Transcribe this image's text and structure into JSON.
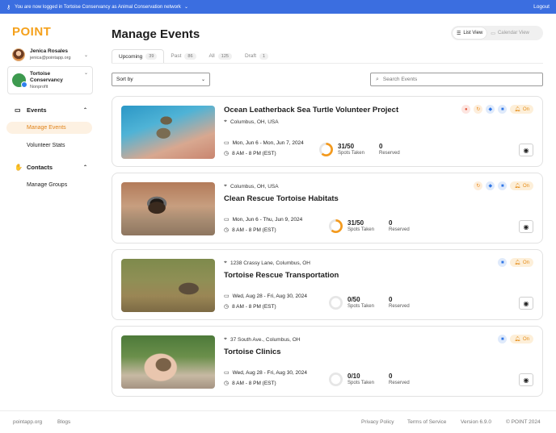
{
  "banner": {
    "message": "You are now logged in Tortoise Conservancy as Animal Conservation network",
    "logout": "Logout"
  },
  "app": {
    "logo": "POINT"
  },
  "user": {
    "name": "Jenica Rosales",
    "email": "jenica@pointapp.org"
  },
  "org": {
    "name": "Tortoise Conservancy",
    "type": "Nonprofit"
  },
  "nav": {
    "events": {
      "label": "Events",
      "items": [
        "Manage Events",
        "Volunteer Stats"
      ]
    },
    "contacts": {
      "label": "Contacts",
      "items": [
        "Manage Groups"
      ]
    }
  },
  "page": {
    "title": "Manage Events"
  },
  "view_toggle": {
    "list": "List View",
    "calendar": "Calendar View"
  },
  "tabs": [
    {
      "label": "Upcoming",
      "count": "39"
    },
    {
      "label": "Past",
      "count": "86"
    },
    {
      "label": "All",
      "count": "125"
    },
    {
      "label": "Draft",
      "count": "1"
    }
  ],
  "filters": {
    "sort_label": "Sort by",
    "search_placeholder": "Search Events"
  },
  "common": {
    "spots_label": "Spots Taken",
    "reserved_label": "Reserved",
    "on_label": "On"
  },
  "events": [
    {
      "title": "Ocean Leatherback Sea Turtle Volunteer Project",
      "location": "Columbus, OH, USA",
      "dates": "Mon, Jun 6 - Mon, Jun 7, 2024",
      "time": "8 AM - 8 PM (EST)",
      "spots": "31/50",
      "reserved": "0",
      "progress": 0.62
    },
    {
      "title": "Clean Rescue Tortoise Habitats",
      "location": "Columbus, OH, USA",
      "dates": "Mon, Jun 6 - Thu, Jun 9, 2024",
      "time": "8 AM - 8 PM (EST)",
      "spots": "31/50",
      "reserved": "0",
      "progress": 0.62
    },
    {
      "title": "Tortoise Rescue Transportation",
      "location": "1238 Crassy Lane, Columbus, OH",
      "dates": "Wed, Aug 28 - Fri, Aug 30, 2024",
      "time": "8 AM - 8 PM (EST)",
      "spots": "0/50",
      "reserved": "0",
      "progress": 0
    },
    {
      "title": "Tortoise Clinics",
      "location": "37 South Ave., Columbus, OH",
      "dates": "Wed, Aug 28 - Fri, Aug 30, 2024",
      "time": "8 AM - 8 PM (EST)",
      "spots": "0/10",
      "reserved": "0",
      "progress": 0
    }
  ],
  "colors": {
    "accent": "#f5a11c",
    "banner": "#3b6ee0",
    "progress": "#f39a1e"
  },
  "footer": {
    "site": "pointapp.org",
    "blogs": "Blogs",
    "privacy": "Privacy Policy",
    "terms": "Terms of Service",
    "version": "Version 6.9.0",
    "copyright": "© POINT 2024"
  }
}
